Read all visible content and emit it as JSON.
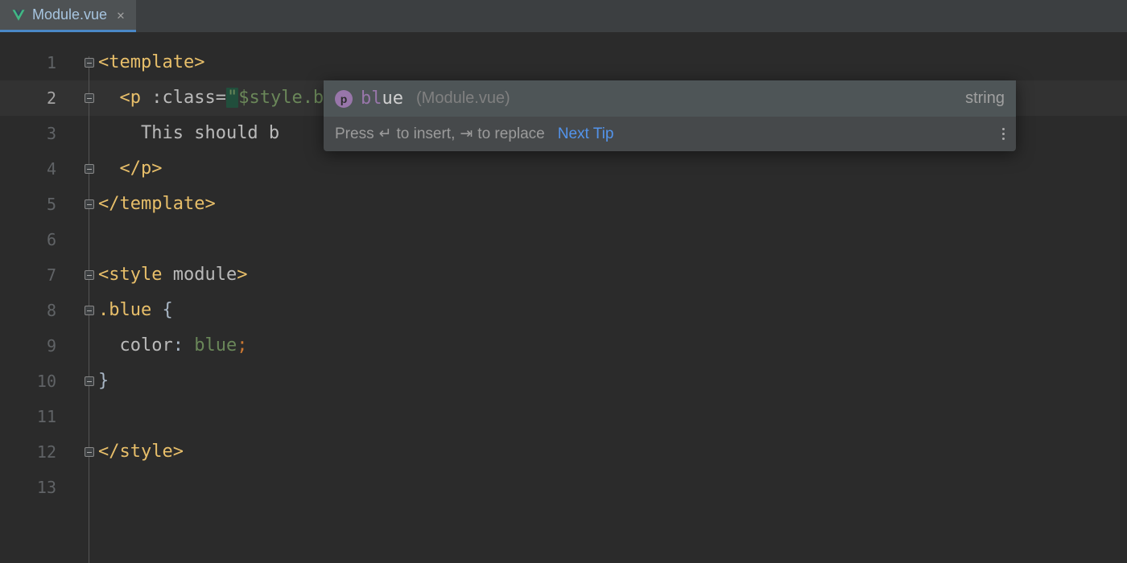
{
  "tab": {
    "label": "Module.vue"
  },
  "code": {
    "line1": {
      "open": "<template>"
    },
    "line2": {
      "indent": "  ",
      "tag_open": "<p ",
      "attr": ":class=",
      "q1": "\"",
      "val": "$style.bl",
      "q2": "\"",
      "tag_close": ">"
    },
    "line3": {
      "indent": "    ",
      "text": "This should b"
    },
    "line4": {
      "indent": "  ",
      "close": "</p>"
    },
    "line5": {
      "close": "</template>"
    },
    "line7": {
      "tag": "<style ",
      "attr": "module",
      "close": ">"
    },
    "line8": {
      "sel": ".blue ",
      "brace": "{"
    },
    "line9": {
      "indent": "  ",
      "prop": "color",
      "colon": ": ",
      "val": "blue",
      "semi": ";"
    },
    "line10": {
      "brace": "}"
    },
    "line12": {
      "close": "</style>"
    }
  },
  "gutter": {
    "lines": [
      "1",
      "2",
      "3",
      "4",
      "5",
      "6",
      "7",
      "8",
      "9",
      "10",
      "11",
      "12",
      "13"
    ],
    "color_swatch_row": 9
  },
  "completion": {
    "icon_letter": "p",
    "match": "bl",
    "rest": "ue",
    "origin": "(Module.vue)",
    "type": "string",
    "footer_pre": "Press ",
    "footer_mid": " to insert, ",
    "footer_post": " to replace",
    "link": "Next Tip"
  }
}
